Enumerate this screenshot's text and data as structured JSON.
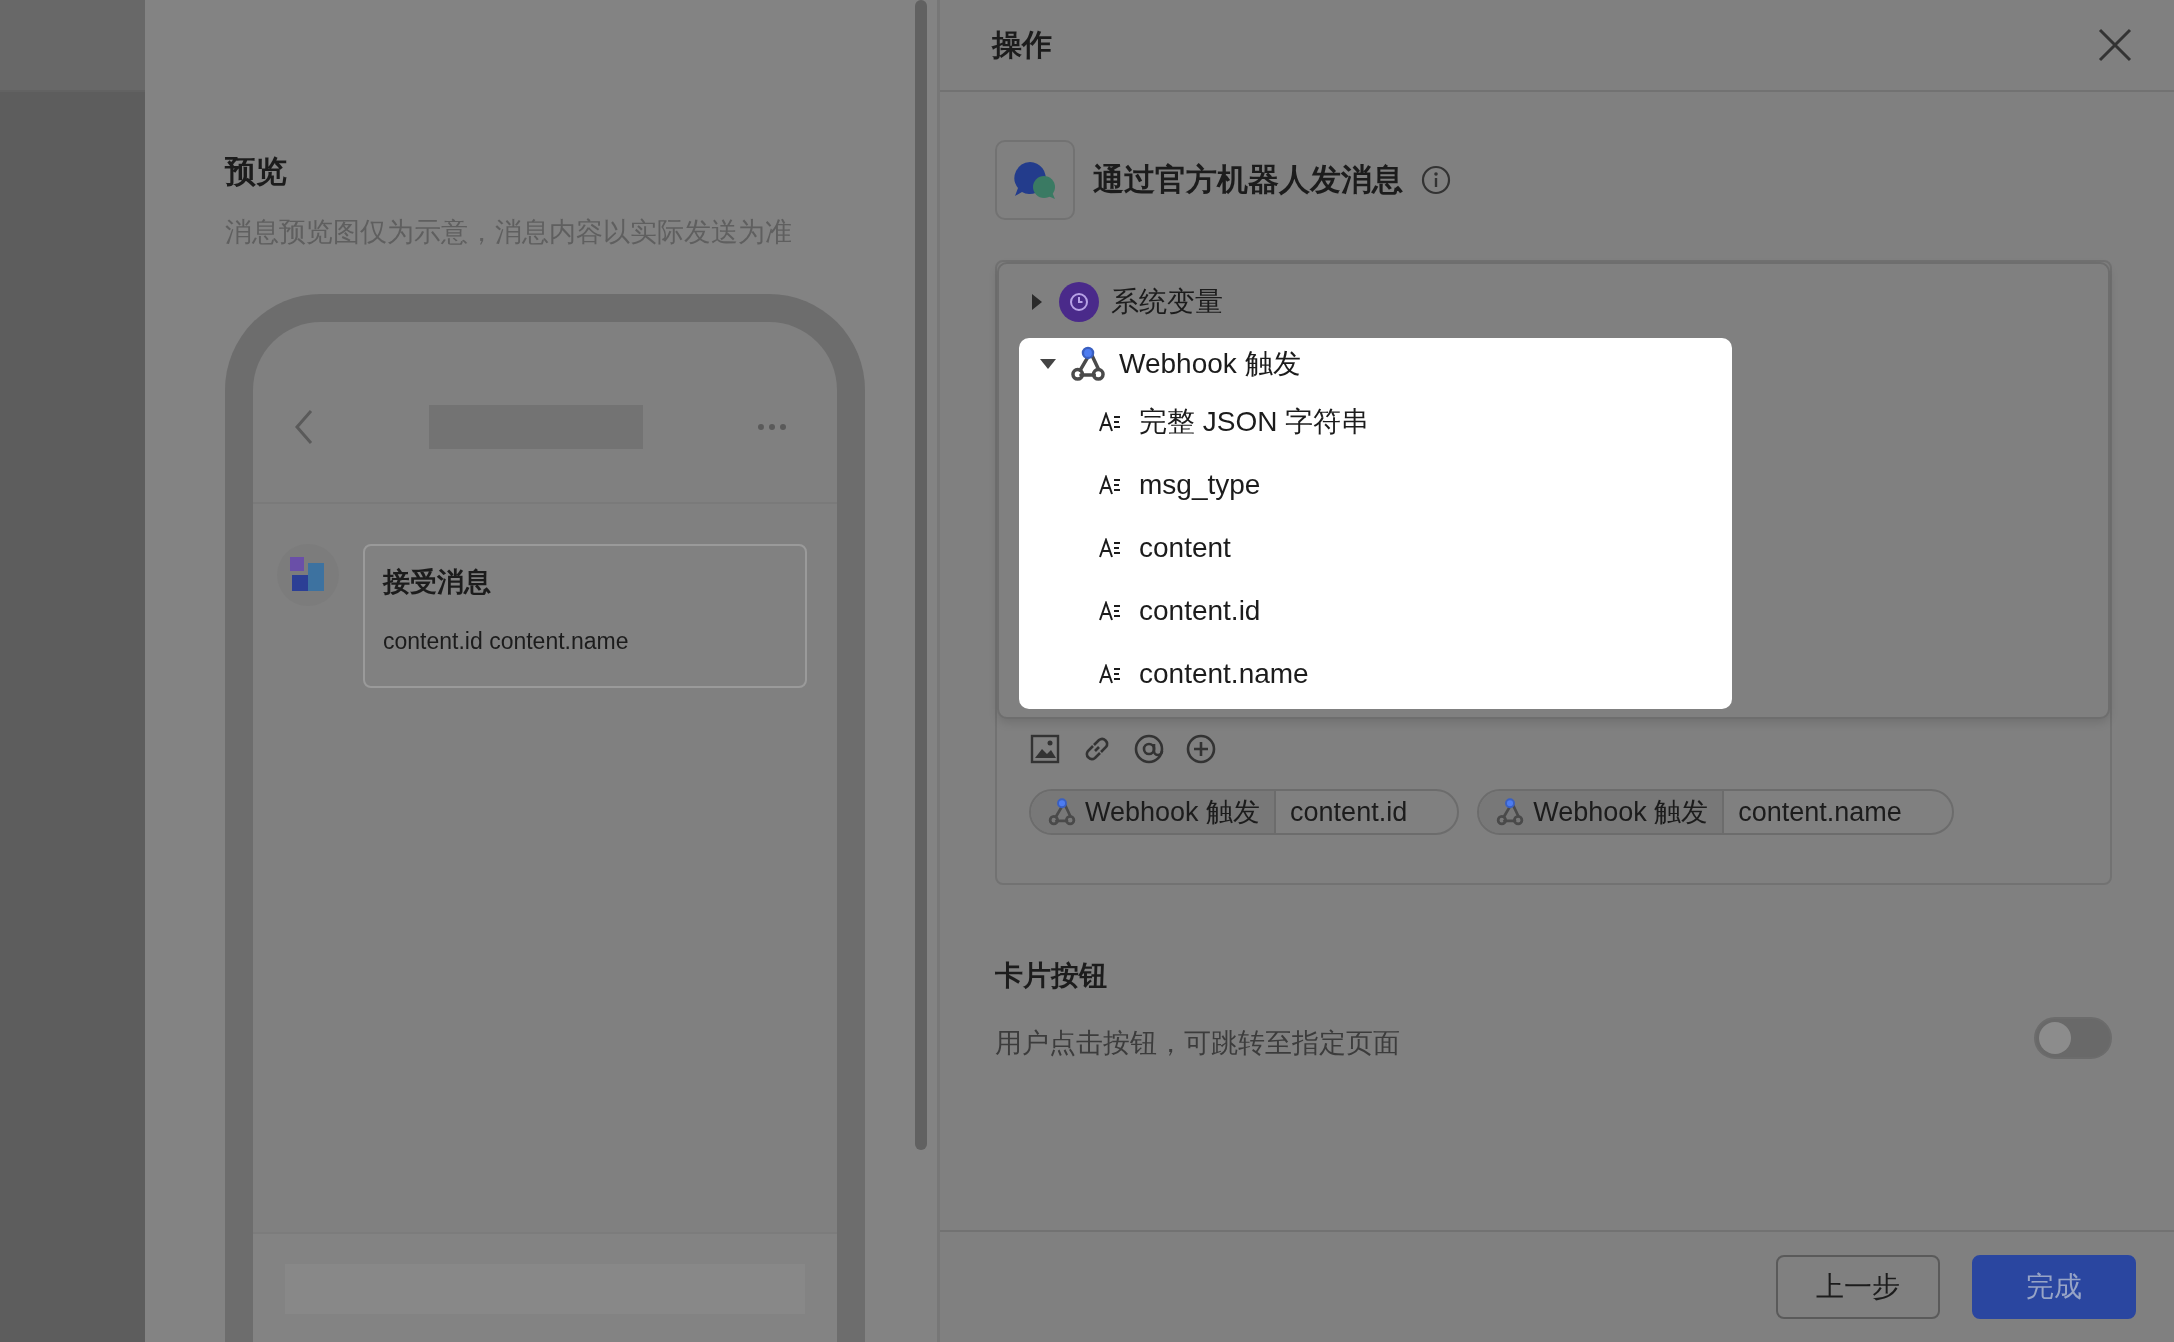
{
  "preview": {
    "title": "预览",
    "subtitle": "消息预览图仅为示意，消息内容以实际发送为准",
    "message_card": {
      "title": "接受消息",
      "body": "content.id content.name"
    }
  },
  "drawer": {
    "title": "操作",
    "action": {
      "title": "通过官方机器人发消息"
    },
    "variable_tree": [
      {
        "kind": "system",
        "label": "系统变量",
        "expanded": false
      },
      {
        "kind": "webhook",
        "label": "Webhook 触发",
        "expanded": true,
        "children": [
          {
            "label": "完整 JSON 字符串"
          },
          {
            "label": "msg_type"
          },
          {
            "label": "content"
          },
          {
            "label": "content.id"
          },
          {
            "label": "content.name"
          }
        ]
      }
    ],
    "tokens": [
      {
        "source": "Webhook 触发",
        "field": "content.id"
      },
      {
        "source": "Webhook 触发",
        "field": "content.name"
      }
    ],
    "card_button": {
      "title": "卡片按钮",
      "description": "用户点击按钮，可跳转至指定页面",
      "on": false
    },
    "buttons": [
      {
        "kind": "secondary",
        "label": "上一步"
      },
      {
        "kind": "primary",
        "label": "完成"
      }
    ]
  }
}
